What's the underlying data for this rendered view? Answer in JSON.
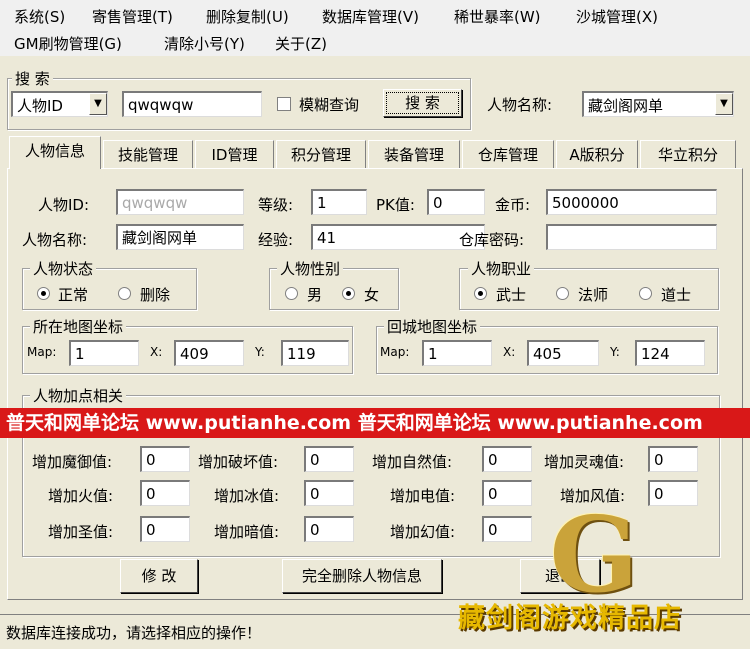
{
  "menu": [
    "系统(S)",
    "寄售管理(T)",
    "删除复制(U)",
    "数据库管理(V)",
    "稀世暴率(W)",
    "沙城管理(X)",
    "GM刷物管理(G)",
    "清除小号(Y)",
    "关于(Z)"
  ],
  "search": {
    "group_title": "搜 索",
    "type_value": "人物ID",
    "query_value": "qwqwqw",
    "fuzzy_label": "模糊查询",
    "button_label": "搜 索",
    "char_name_label": "人物名称:",
    "char_name_value": "藏剑阁网单"
  },
  "tabs": [
    "人物信息",
    "技能管理",
    "ID管理",
    "积分管理",
    "装备管理",
    "仓库管理",
    "A版积分",
    "华立积分"
  ],
  "info": {
    "id_label": "人物ID:",
    "id_value": "qwqwqw",
    "level_label": "等级:",
    "level_value": "1",
    "pk_label": "PK值:",
    "pk_value": "0",
    "gold_label": "金币:",
    "gold_value": "5000000",
    "name_label": "人物名称:",
    "name_value": "藏剑阁网单",
    "exp_label": "经验:",
    "exp_value": "41",
    "warehouse_pw_label": "仓库密码:",
    "warehouse_pw_value": ""
  },
  "status_group": {
    "title": "人物状态",
    "normal": "正常",
    "deleted": "删除"
  },
  "gender_group": {
    "title": "人物性别",
    "male": "男",
    "female": "女"
  },
  "job_group": {
    "title": "人物职业",
    "warrior": "武士",
    "mage": "法师",
    "taoist": "道士"
  },
  "map_group": {
    "title": "所在地图坐标",
    "map_label": "Map:",
    "map_value": "1",
    "x_label": "X:",
    "x_value": "409",
    "y_label": "Y:",
    "y_value": "119"
  },
  "return_group": {
    "title": "回城地图坐标",
    "map_label": "Map:",
    "map_value": "1",
    "x_label": "X:",
    "x_value": "405",
    "y_label": "Y:",
    "y_value": "124"
  },
  "points_group": {
    "title": "人物加点相关",
    "fields": [
      {
        "label": "增加魔御值:",
        "value": "0"
      },
      {
        "label": "增加破坏值:",
        "value": "0"
      },
      {
        "label": "增加自然值:",
        "value": "0"
      },
      {
        "label": "增加灵魂值:",
        "value": "0"
      },
      {
        "label": "增加火值:",
        "value": "0"
      },
      {
        "label": "增加冰值:",
        "value": "0"
      },
      {
        "label": "增加电值:",
        "value": "0"
      },
      {
        "label": "增加风值:",
        "value": "0"
      },
      {
        "label": "增加圣值:",
        "value": "0"
      },
      {
        "label": "增加暗值:",
        "value": "0"
      },
      {
        "label": "增加幻值:",
        "value": "0"
      }
    ]
  },
  "buttons": {
    "modify": "修 改",
    "delete_all": "完全删除人物信息",
    "exit": "退出"
  },
  "banner": {
    "text": "普天和网单论坛 www.putianhe.com 普天和网单论坛 www.putianhe.com"
  },
  "logo": {
    "letter": "G",
    "text": "藏剑阁游戏精品店"
  },
  "statusbar": "数据库连接成功，请选择相应的操作！",
  "colors": {
    "banner_bg": "#d91818",
    "banner_fg": "#ffffff",
    "logo_gold": "#e6b800",
    "window_bg": "#ece9d8"
  }
}
